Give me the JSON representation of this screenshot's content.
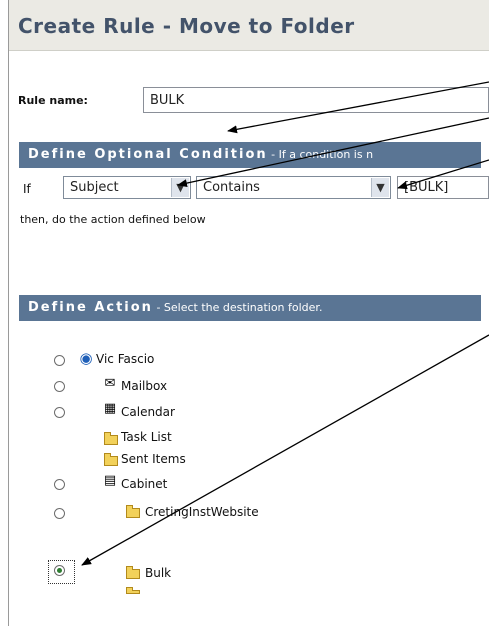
{
  "title": "Create Rule - Move to Folder",
  "rule_name": {
    "label": "Rule name:",
    "value": "BULK"
  },
  "condition": {
    "heading": "Define Optional Condition",
    "hint": " - If a condition is n",
    "if_label": "If",
    "field": "Subject",
    "operator": "Contains",
    "value": "[BULK]",
    "then_text": "then, do the action defined below"
  },
  "action": {
    "heading": "Define Action",
    "hint": " - Select the destination folder.",
    "tree": [
      {
        "label": "Vic Fascio",
        "icon": "globe-user-icon",
        "radio": true,
        "selected": false
      },
      {
        "label": "Mailbox",
        "icon": "mailbox-icon",
        "radio": true,
        "selected": false
      },
      {
        "label": "Calendar",
        "icon": "calendar-icon",
        "radio": true,
        "selected": false
      },
      {
        "label": "Task List",
        "icon": "task-folder-icon",
        "radio": false,
        "selected": false
      },
      {
        "label": "Sent Items",
        "icon": "sent-folder-icon",
        "radio": false,
        "selected": false
      },
      {
        "label": "Cabinet",
        "icon": "cabinet-icon",
        "radio": true,
        "selected": false
      },
      {
        "label": "CretingInstWebsite",
        "icon": "folder-icon",
        "radio": true,
        "selected": false
      },
      {
        "label": "Bulk",
        "icon": "folder-icon",
        "radio": true,
        "selected": true
      }
    ]
  },
  "colors": {
    "band": "#5a7594",
    "title": "#43536a",
    "arrow": "#000000"
  }
}
